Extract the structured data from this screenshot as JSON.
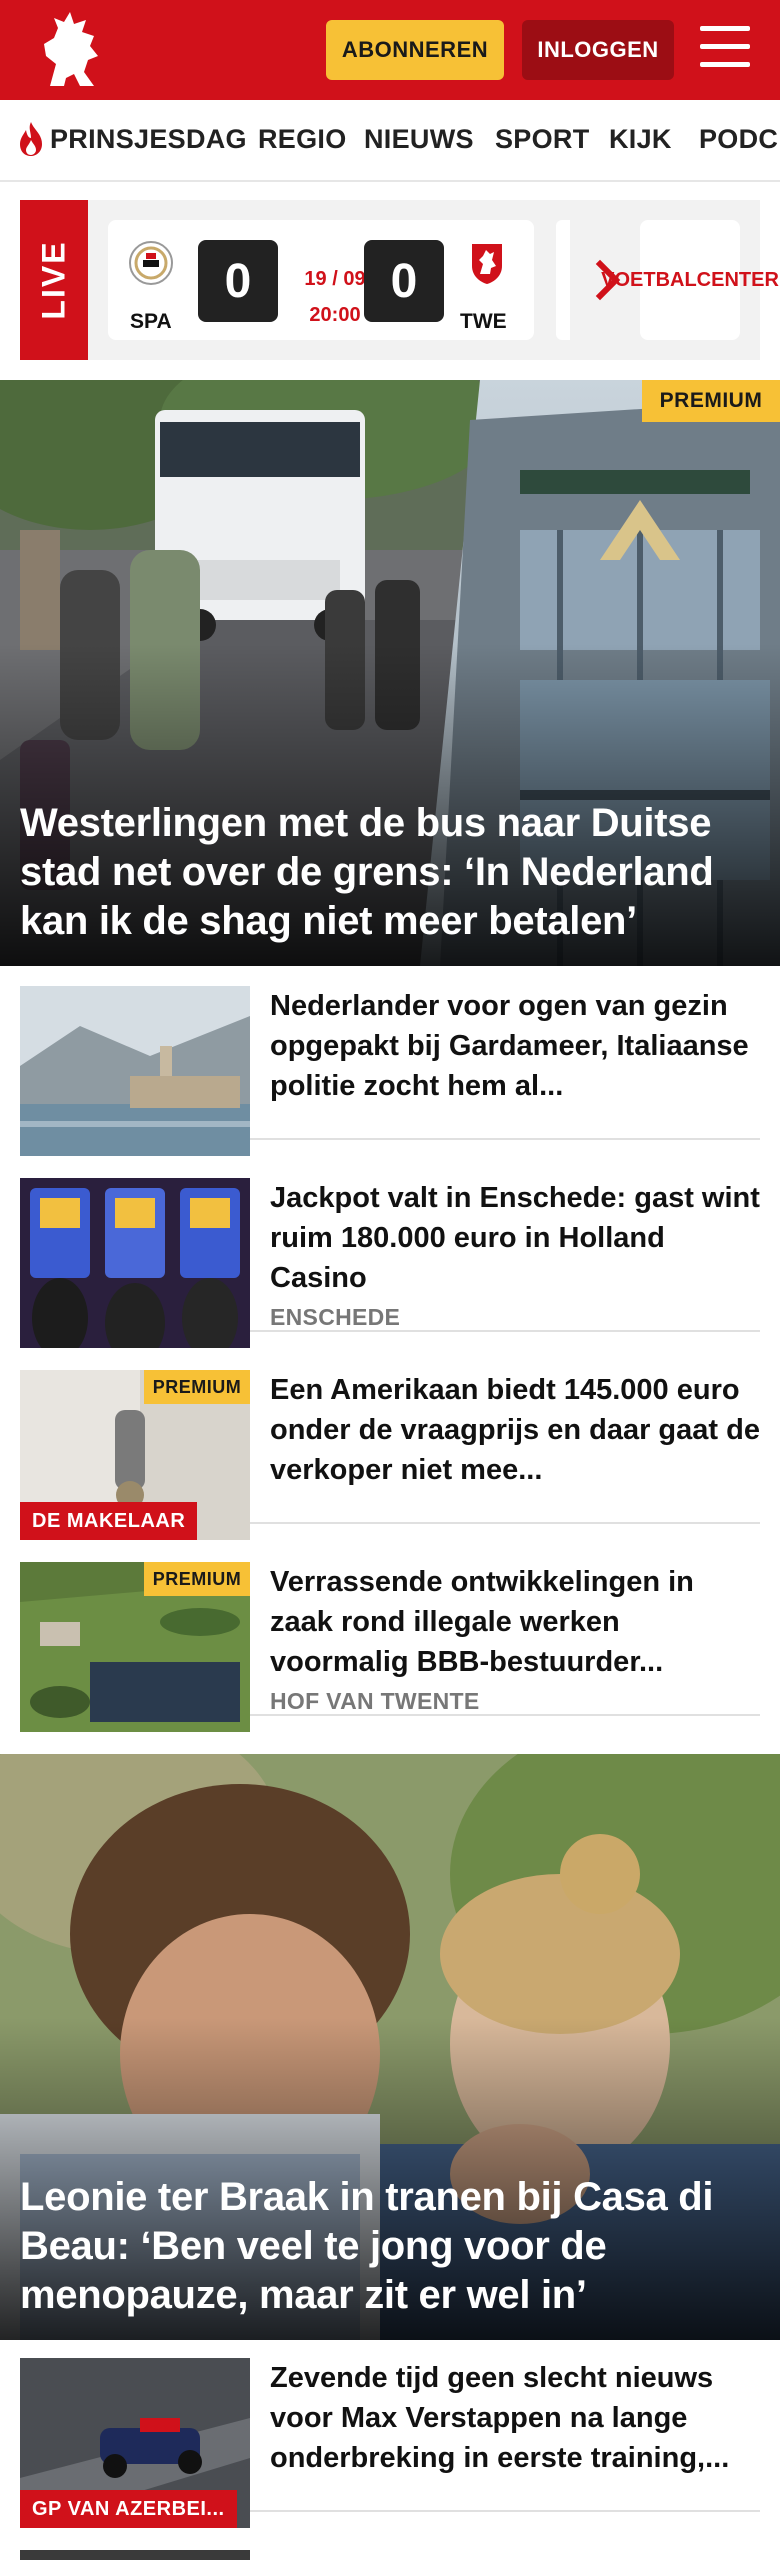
{
  "header": {
    "subscribe_label": "ABONNEREN",
    "login_label": "INLOGGEN"
  },
  "nav": {
    "items": [
      "PRINSJESDAG",
      "REGIO",
      "NIEUWS",
      "SPORT",
      "KIJK",
      "PODC"
    ]
  },
  "live_widget": {
    "live_label": "LIVE",
    "match": {
      "home_abbr": "SPA",
      "away_abbr": "TWE",
      "home_score": "0",
      "away_score": "0",
      "date": "19 / 09",
      "time": "20:00"
    },
    "voetbal_center_label": "VOETBAL CENTER"
  },
  "hero": {
    "premium_label": "PREMIUM",
    "title": "Westerlingen met de bus naar Duitse stad net over de grens: ‘In Nederland kan ik de shag niet meer betalen’"
  },
  "articles": [
    {
      "title": "Nederlander voor ogen van gezin opgepakt bij Gardameer, Italiaanse politie zocht hem al...",
      "category": "",
      "premium_label": "",
      "tag_label": ""
    },
    {
      "title": "Jackpot valt in Enschede: gast wint ruim 180.000 euro in Holland Casino",
      "category": "ENSCHEDE",
      "premium_label": "",
      "tag_label": ""
    },
    {
      "title": "Een Amerikaan biedt 145.000 euro onder de vraagprijs en daar gaat de verkoper niet mee...",
      "category": "",
      "premium_label": "PREMIUM",
      "tag_label": "DE MAKELAAR"
    },
    {
      "title": "Verrassende ontwikkelingen in zaak rond illegale werken voormalig BBB-bestuurder...",
      "category": "HOF VAN TWENTE",
      "premium_label": "PREMIUM",
      "tag_label": ""
    }
  ],
  "hero2": {
    "title": "Leonie ter Braak in tranen bij Casa di Beau: ‘Ben veel te jong voor de menopauze, maar zit er wel in’"
  },
  "article_after": {
    "title": "Zevende tijd geen slecht nieuws voor Max Verstappen na lange onderbreking in eerste training,...",
    "tag_label": "GP VAN AZERBEI..."
  },
  "colors": {
    "brand_red": "#d0111a",
    "premium_yellow": "#f7c136",
    "login_dark_red": "#9c0d14"
  }
}
